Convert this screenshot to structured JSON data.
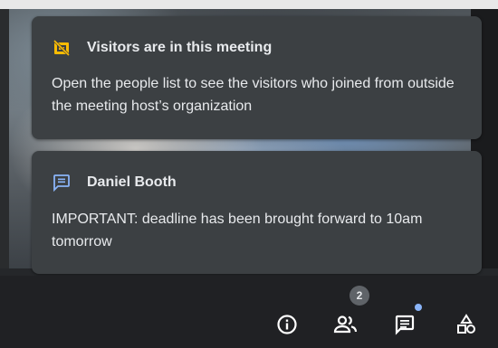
{
  "notifications": {
    "visitors": {
      "icon": "visitors-alert-icon",
      "title": "Visitors are in this meeting",
      "body": "Open the people list to see the visitors who joined from outside the meeting host’s organization"
    },
    "message": {
      "icon": "chat-message-icon",
      "sender": "Daniel Booth",
      "body": "IMPORTANT: deadline has been brought forward to 10am tomorrow"
    }
  },
  "toolbar": {
    "buttons": [
      {
        "name": "info",
        "icon": "info-icon"
      },
      {
        "name": "people",
        "icon": "people-icon"
      },
      {
        "name": "chat",
        "icon": "chat-icon"
      },
      {
        "name": "activities",
        "icon": "activities-icon"
      }
    ],
    "people_count": "2"
  },
  "colors": {
    "card_bg": "#3c4043",
    "toolbar_bg": "#202124",
    "visitor_icon": "#fbbc04",
    "chat_icon": "#8ab4f8",
    "text": "#e8eaed",
    "badge_bg": "#5f6368",
    "dot": "#8ab4f8"
  }
}
